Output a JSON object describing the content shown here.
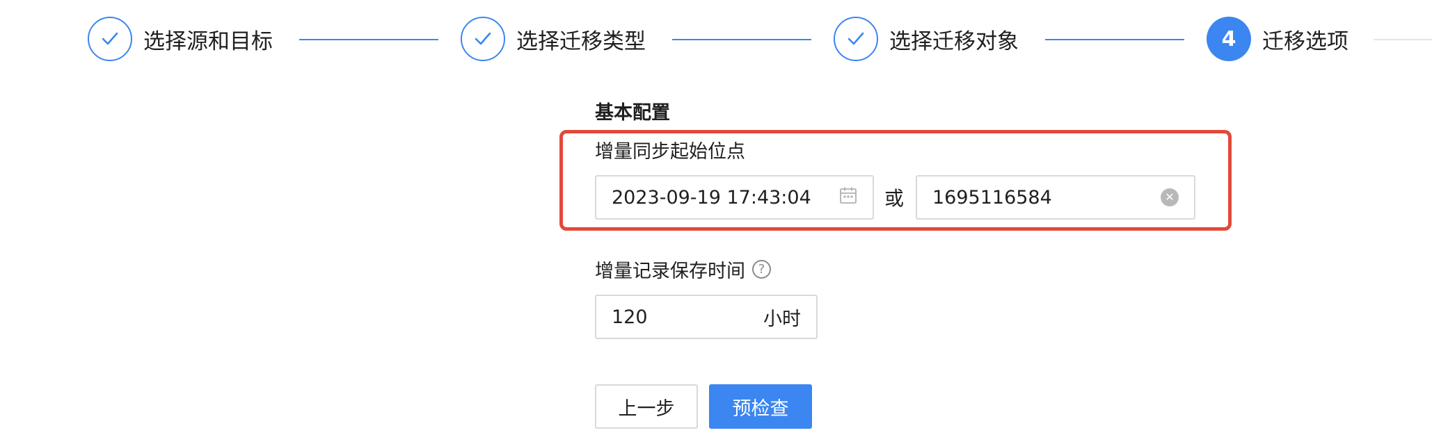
{
  "steps": [
    {
      "label": "选择源和目标",
      "status": "done",
      "icon": "check-icon"
    },
    {
      "label": "选择迁移类型",
      "status": "done",
      "icon": "check-icon"
    },
    {
      "label": "选择迁移对象",
      "status": "done",
      "icon": "check-icon"
    },
    {
      "label": "迁移选项",
      "status": "active",
      "number": "4"
    }
  ],
  "form": {
    "section_title": "基本配置",
    "start_position": {
      "label": "增量同步起始位点",
      "datetime_value": "2023-09-19 17:43:04",
      "or_text": "或",
      "timestamp_value": "1695116584"
    },
    "retention": {
      "label": "增量记录保存时间",
      "help_icon": "?",
      "value": "120",
      "unit": "小时"
    }
  },
  "buttons": {
    "prev_label": "上一步",
    "precheck_label": "预检查"
  },
  "colors": {
    "accent": "#3b86f0",
    "highlight": "#e14a3b"
  }
}
